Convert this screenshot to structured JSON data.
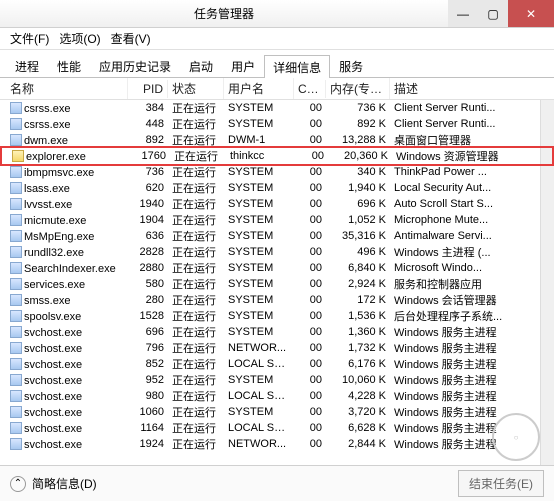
{
  "window": {
    "title": "任务管理器"
  },
  "menu": {
    "file": "文件(F)",
    "options": "选项(O)",
    "view": "查看(V)"
  },
  "tabs": [
    "进程",
    "性能",
    "应用历史记录",
    "启动",
    "用户",
    "详细信息",
    "服务"
  ],
  "activeTab": 5,
  "columns": {
    "name": "名称",
    "pid": "PID",
    "status": "状态",
    "user": "用户名",
    "cpu": "CPU",
    "mem": "内存(专用...",
    "desc": "描述"
  },
  "rows": [
    {
      "name": "csrss.exe",
      "pid": "384",
      "status": "正在运行",
      "user": "SYSTEM",
      "cpu": "00",
      "mem": "736 K",
      "desc": "Client Server Runti..."
    },
    {
      "name": "csrss.exe",
      "pid": "448",
      "status": "正在运行",
      "user": "SYSTEM",
      "cpu": "00",
      "mem": "892 K",
      "desc": "Client Server Runti..."
    },
    {
      "name": "dwm.exe",
      "pid": "892",
      "status": "正在运行",
      "user": "DWM-1",
      "cpu": "00",
      "mem": "13,288 K",
      "desc": "桌面窗口管理器"
    },
    {
      "name": "explorer.exe",
      "pid": "1760",
      "status": "正在运行",
      "user": "thinkcc",
      "cpu": "00",
      "mem": "20,360 K",
      "desc": "Windows 资源管理器",
      "highlight": true,
      "folder": true
    },
    {
      "name": "ibmpmsvc.exe",
      "pid": "736",
      "status": "正在运行",
      "user": "SYSTEM",
      "cpu": "00",
      "mem": "340 K",
      "desc": "ThinkPad Power ..."
    },
    {
      "name": "lsass.exe",
      "pid": "620",
      "status": "正在运行",
      "user": "SYSTEM",
      "cpu": "00",
      "mem": "1,940 K",
      "desc": "Local Security Aut..."
    },
    {
      "name": "lvvsst.exe",
      "pid": "1940",
      "status": "正在运行",
      "user": "SYSTEM",
      "cpu": "00",
      "mem": "696 K",
      "desc": "Auto Scroll Start S..."
    },
    {
      "name": "micmute.exe",
      "pid": "1904",
      "status": "正在运行",
      "user": "SYSTEM",
      "cpu": "00",
      "mem": "1,052 K",
      "desc": "Microphone Mute..."
    },
    {
      "name": "MsMpEng.exe",
      "pid": "636",
      "status": "正在运行",
      "user": "SYSTEM",
      "cpu": "00",
      "mem": "35,316 K",
      "desc": "Antimalware Servi..."
    },
    {
      "name": "rundll32.exe",
      "pid": "2828",
      "status": "正在运行",
      "user": "SYSTEM",
      "cpu": "00",
      "mem": "496 K",
      "desc": "Windows 主进程 (..."
    },
    {
      "name": "SearchIndexer.exe",
      "pid": "2880",
      "status": "正在运行",
      "user": "SYSTEM",
      "cpu": "00",
      "mem": "6,840 K",
      "desc": "Microsoft Windo..."
    },
    {
      "name": "services.exe",
      "pid": "580",
      "status": "正在运行",
      "user": "SYSTEM",
      "cpu": "00",
      "mem": "2,924 K",
      "desc": "服务和控制器应用"
    },
    {
      "name": "smss.exe",
      "pid": "280",
      "status": "正在运行",
      "user": "SYSTEM",
      "cpu": "00",
      "mem": "172 K",
      "desc": "Windows 会话管理器"
    },
    {
      "name": "spoolsv.exe",
      "pid": "1528",
      "status": "正在运行",
      "user": "SYSTEM",
      "cpu": "00",
      "mem": "1,536 K",
      "desc": "后台处理程序子系统..."
    },
    {
      "name": "svchost.exe",
      "pid": "696",
      "status": "正在运行",
      "user": "SYSTEM",
      "cpu": "00",
      "mem": "1,360 K",
      "desc": "Windows 服务主进程"
    },
    {
      "name": "svchost.exe",
      "pid": "796",
      "status": "正在运行",
      "user": "NETWOR...",
      "cpu": "00",
      "mem": "1,732 K",
      "desc": "Windows 服务主进程"
    },
    {
      "name": "svchost.exe",
      "pid": "852",
      "status": "正在运行",
      "user": "LOCAL SE...",
      "cpu": "00",
      "mem": "6,176 K",
      "desc": "Windows 服务主进程"
    },
    {
      "name": "svchost.exe",
      "pid": "952",
      "status": "正在运行",
      "user": "SYSTEM",
      "cpu": "00",
      "mem": "10,060 K",
      "desc": "Windows 服务主进程"
    },
    {
      "name": "svchost.exe",
      "pid": "980",
      "status": "正在运行",
      "user": "LOCAL SE...",
      "cpu": "00",
      "mem": "4,228 K",
      "desc": "Windows 服务主进程"
    },
    {
      "name": "svchost.exe",
      "pid": "1060",
      "status": "正在运行",
      "user": "SYSTEM",
      "cpu": "00",
      "mem": "3,720 K",
      "desc": "Windows 服务主进程"
    },
    {
      "name": "svchost.exe",
      "pid": "1164",
      "status": "正在运行",
      "user": "LOCAL SE...",
      "cpu": "00",
      "mem": "6,628 K",
      "desc": "Windows 服务主进程"
    },
    {
      "name": "svchost.exe",
      "pid": "1924",
      "status": "正在运行",
      "user": "NETWOR...",
      "cpu": "00",
      "mem": "2,844 K",
      "desc": "Windows 服务主进程"
    }
  ],
  "footer": {
    "simple": "简略信息(D)",
    "endTask": "结束任务(E)"
  }
}
